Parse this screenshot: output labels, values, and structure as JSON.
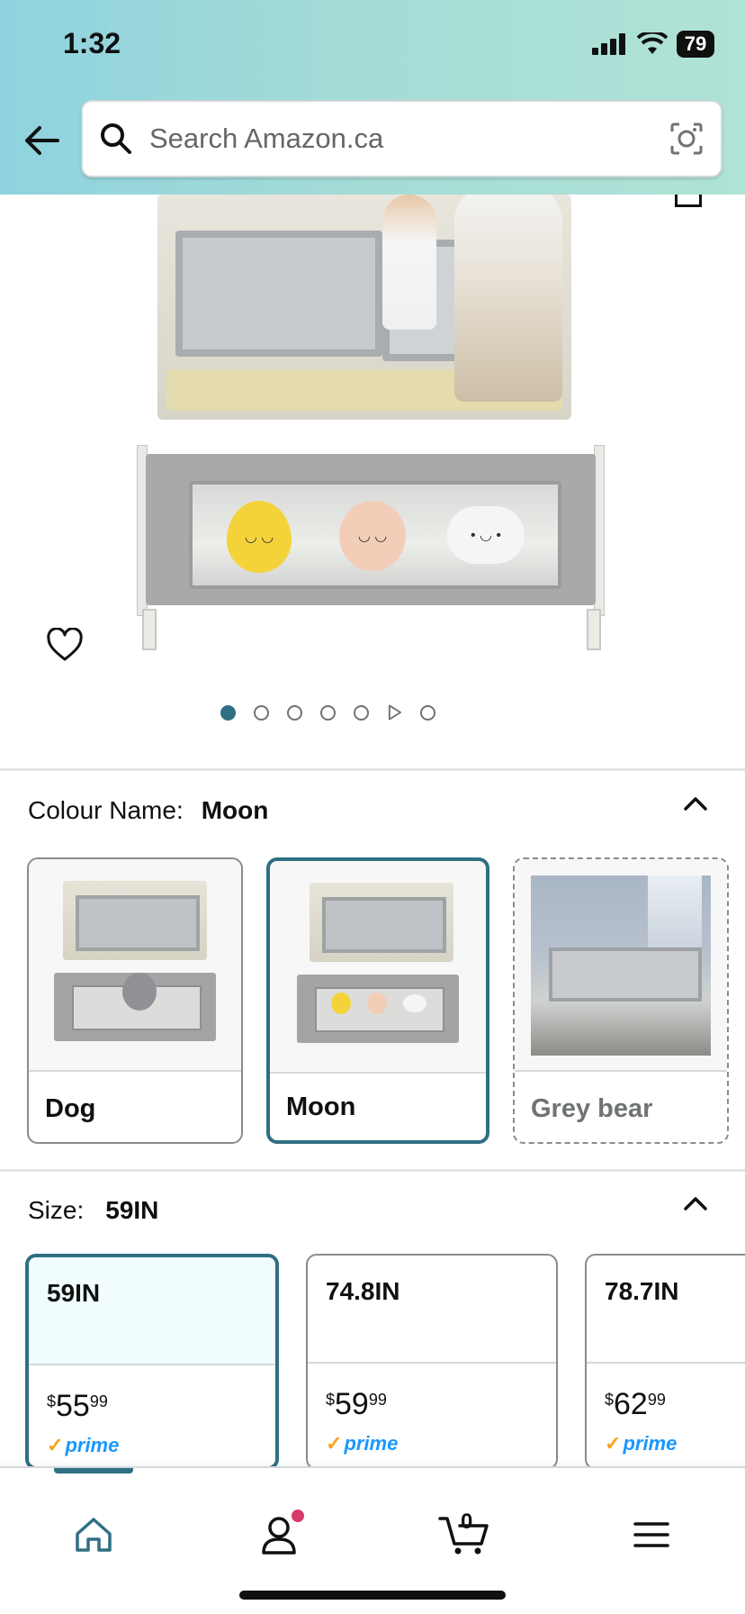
{
  "status_bar": {
    "time": "1:32",
    "battery": "79"
  },
  "search": {
    "placeholder": "Search Amazon.ca"
  },
  "gallery": {
    "dot_count": 7,
    "active_index": 0
  },
  "colour": {
    "label": "Colour Name:",
    "selected": "Moon",
    "options": [
      {
        "name": "Dog",
        "state": "available"
      },
      {
        "name": "Moon",
        "state": "selected"
      },
      {
        "name": "Grey bear",
        "state": "unavailable"
      }
    ]
  },
  "size": {
    "label": "Size:",
    "selected": "59IN",
    "options": [
      {
        "name": "59IN",
        "symbol": "$",
        "dollars": "55",
        "cents": "99",
        "prime": "prime"
      },
      {
        "name": "74.8IN",
        "symbol": "$",
        "dollars": "59",
        "cents": "99",
        "prime": "prime"
      },
      {
        "name": "78.7IN",
        "symbol": "$",
        "dollars": "62",
        "cents": "99",
        "prime": "prime"
      }
    ]
  },
  "nav": {
    "cart_count": "0"
  },
  "colors": {
    "accent": "#2f6f84",
    "prime_blue": "#1a98ff",
    "prime_check": "#f7a21b",
    "notification": "#d63a6b"
  },
  "icons": [
    "back-arrow-icon",
    "search-icon",
    "camera-lens-icon",
    "heart-icon",
    "chevron-up-icon",
    "home-icon",
    "profile-icon",
    "cart-icon",
    "menu-icon"
  ]
}
